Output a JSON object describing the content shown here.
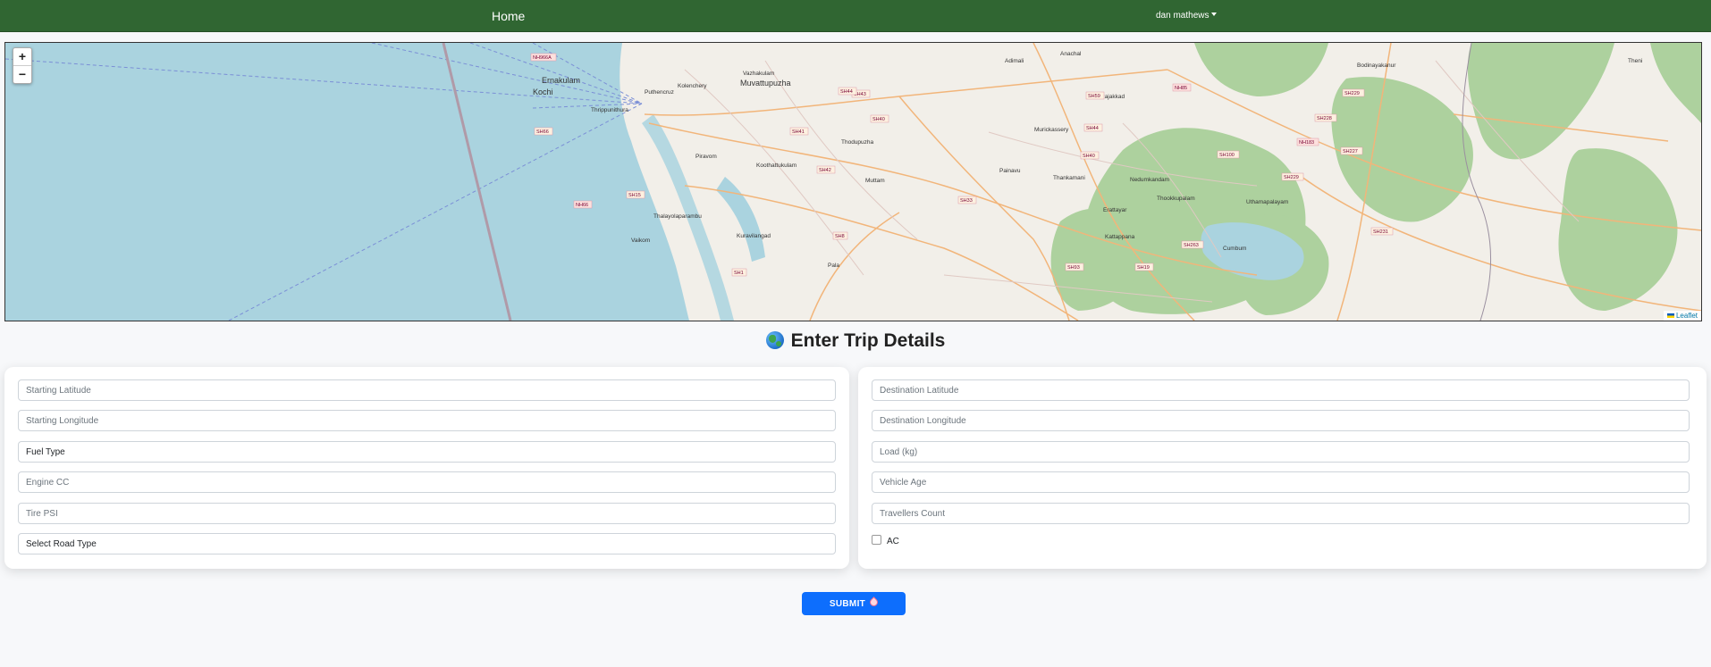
{
  "nav": {
    "home_label": "Home",
    "user_label": "dan mathews"
  },
  "map": {
    "zoom_in": "+",
    "zoom_out": "−",
    "attribution": "Leaflet",
    "places": [
      {
        "name": "Ernakulam"
      },
      {
        "name": "Kochi"
      },
      {
        "name": "Muvattupuzha"
      },
      {
        "name": "Puthencruz"
      },
      {
        "name": "Kolenchery"
      },
      {
        "name": "Thrippunithura"
      },
      {
        "name": "Thodupuzha"
      },
      {
        "name": "Piravom"
      },
      {
        "name": "Koothattukulam"
      },
      {
        "name": "Muttam"
      },
      {
        "name": "Painavu"
      },
      {
        "name": "Thankamani"
      },
      {
        "name": "Nedumkandam"
      },
      {
        "name": "Thookkupalam"
      },
      {
        "name": "Uthamapalayam"
      },
      {
        "name": "Bodinayakanur"
      },
      {
        "name": "Rajakkad"
      },
      {
        "name": "Murickassery"
      },
      {
        "name": "Adimali"
      },
      {
        "name": "Anachal"
      },
      {
        "name": "Erattayar"
      },
      {
        "name": "Kattappana"
      },
      {
        "name": "Kuravilangad"
      },
      {
        "name": "Vaikom"
      },
      {
        "name": "Thalayolaparambu"
      },
      {
        "name": "Pala"
      },
      {
        "name": "Cumbum"
      },
      {
        "name": "Theni"
      },
      {
        "name": "Vazhakulam"
      }
    ],
    "roads": [
      "NH966A",
      "SH66",
      "NH66",
      "SH15",
      "SH41",
      "SH43",
      "SH40",
      "SH44",
      "SH42",
      "SH8",
      "SH33",
      "SH59",
      "SH44",
      "SH40",
      "NH85",
      "NH183",
      "SH229",
      "SH228",
      "SH227",
      "SH100",
      "SH229",
      "SH231",
      "SH263",
      "SH19",
      "SH93",
      "SH1"
    ]
  },
  "heading": "Enter Trip Details",
  "form": {
    "left": {
      "start_lat_placeholder": "Starting Latitude",
      "start_lon_placeholder": "Starting Longitude",
      "fuel_type": "Fuel Type",
      "engine_cc_placeholder": "Engine CC",
      "tire_psi_placeholder": "Tire PSI",
      "road_type": "Select Road Type"
    },
    "right": {
      "dest_lat_placeholder": "Destination Latitude",
      "dest_lon_placeholder": "Destination Longitude",
      "load_placeholder": "Load (kg)",
      "vehicle_age_placeholder": "Vehicle Age",
      "travellers_placeholder": "Travellers Count",
      "ac_label": "AC"
    }
  },
  "submit_label": "SUBMIT",
  "colors": {
    "navbar": "#306632",
    "sea": "#aad3df",
    "forest": "#add19e",
    "button": "#0d6efd"
  },
  "icons": {
    "heading": "globe-icon",
    "submit": "rocket-icon"
  }
}
